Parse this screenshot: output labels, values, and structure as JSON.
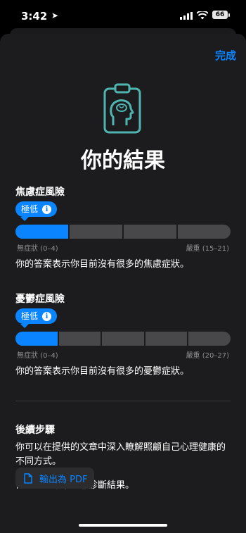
{
  "status": {
    "time": "3:42",
    "battery": "66"
  },
  "header": {
    "done_label": "完成"
  },
  "title": "你的結果",
  "icons": [
    "location-arrow-icon",
    "signal-icon",
    "wifi-icon",
    "battery-icon",
    "clipboard-brain-icon",
    "info-icon",
    "document-icon"
  ],
  "anxiety": {
    "title": "焦慮症風險",
    "level": "極低",
    "range_low": "無症狀 (0–4)",
    "range_high": "嚴重 (15–21)",
    "description": "你的答案表示你目前沒有很多的焦慮症狀。"
  },
  "depression": {
    "title": "憂鬱症風險",
    "level": "極低",
    "range_low": "無症狀 (0–4)",
    "range_high": "嚴重 (20–27)",
    "description": "你的答案表示你目前沒有很多的憂鬱症狀。"
  },
  "next_steps": {
    "title": "後續步驟",
    "body": "你可以在提供的文章中深入瞭解照顧自己心理健康的不同方式。",
    "disclaimer": "你的問卷結果並非診斷結果。",
    "export_label": "輸出為 PDF"
  },
  "colors": {
    "accent": "#0a84ff",
    "sheet": "#1c1c1e",
    "track": "#48484a",
    "icon_teal": "#4fb5b0"
  }
}
